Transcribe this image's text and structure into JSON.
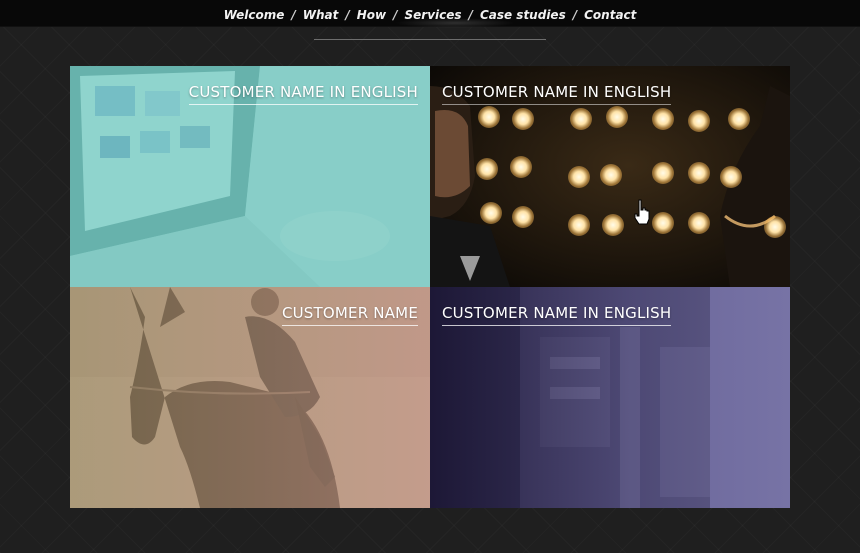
{
  "nav": {
    "items": [
      "Welcome",
      "What",
      "How",
      "Services",
      "Case studies",
      "Contact"
    ],
    "separator": "/"
  },
  "tiles": [
    {
      "caption": "CUSTOMER NAME IN ENGLISH",
      "overlay_color": "#6ecfc6"
    },
    {
      "caption": "CUSTOMER NAME IN ENGLISH",
      "overlay_color": "#1a120a"
    },
    {
      "caption": "CUSTOMER NAME",
      "overlay_color": "#d8a596"
    },
    {
      "caption": "CUSTOMER NAME IN ENGLISH",
      "overlay_color": "#7e7ab4"
    }
  ],
  "colors": {
    "background": "#1f1f1f",
    "topbar": "#080808"
  },
  "icons": [
    "hand-pointer-icon"
  ]
}
